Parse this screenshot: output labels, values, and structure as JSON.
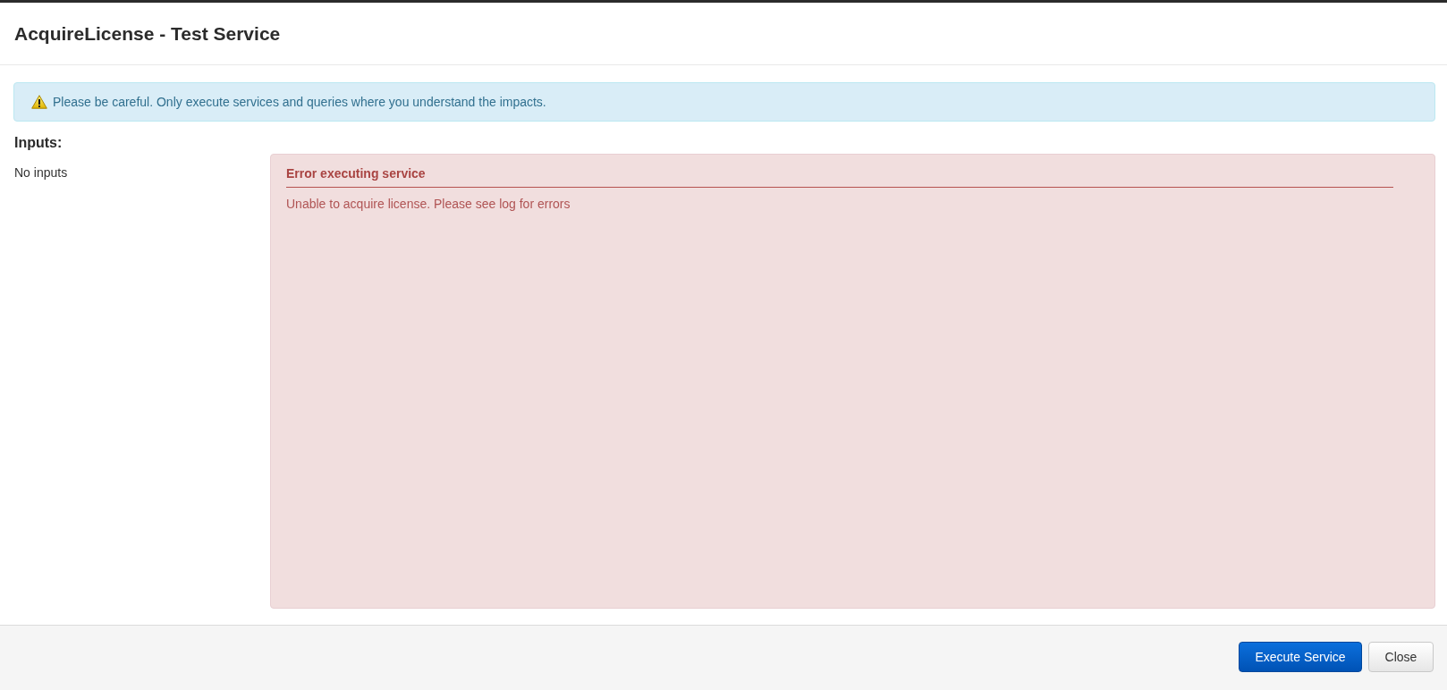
{
  "modal": {
    "title": "AcquireLicense - Test Service"
  },
  "alert": {
    "text": "Please be careful. Only execute services and queries where you understand the impacts."
  },
  "inputs": {
    "heading": "Inputs:",
    "empty_text": "No inputs"
  },
  "error_panel": {
    "title": "Error executing service",
    "message": "Unable to acquire license. Please see log for errors"
  },
  "footer": {
    "buttons": [
      {
        "label": "Execute Service",
        "kind": "primary"
      },
      {
        "label": "Close",
        "kind": "default"
      }
    ]
  }
}
